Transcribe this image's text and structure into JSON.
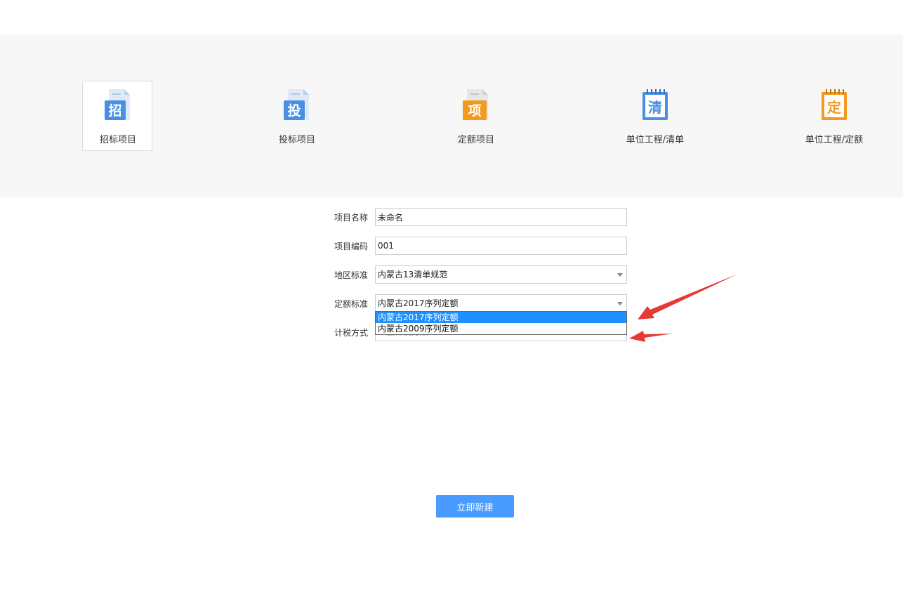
{
  "project_types": [
    {
      "label": "招标项目",
      "icon_glyph": "招",
      "icon": "tender-doc-icon",
      "color": "#4a90e2",
      "selected": true
    },
    {
      "label": "投标项目",
      "icon_glyph": "投",
      "icon": "bid-doc-icon",
      "color": "#4a90e2",
      "selected": false
    },
    {
      "label": "定额项目",
      "icon_glyph": "项",
      "icon": "quota-project-doc-icon",
      "color": "#f39a1e",
      "selected": false
    },
    {
      "label": "单位工程/清单",
      "icon_glyph": "清",
      "icon": "unit-list-notepad-icon",
      "color": "#4a90e2",
      "selected": false
    },
    {
      "label": "单位工程/定额",
      "icon_glyph": "定",
      "icon": "unit-quota-notepad-icon",
      "color": "#f39a1e",
      "selected": false
    }
  ],
  "form": {
    "project_name": {
      "label": "项目名称",
      "value": "未命名"
    },
    "project_code": {
      "label": "项目编码",
      "value": "001"
    },
    "region_standard": {
      "label": "地区标准",
      "value": "内蒙古13清单规范"
    },
    "quota_standard": {
      "label": "定额标准",
      "value": "内蒙古2017序列定额",
      "options": [
        "内蒙古2017序列定额",
        "内蒙古2009序列定额"
      ],
      "highlighted_index": 0
    },
    "tax_method": {
      "label": "计税方式",
      "value": "一般计税方法"
    }
  },
  "create_button_label": "立即新建",
  "colors": {
    "accent": "#4a9bff",
    "highlight": "#1e90ff",
    "annotation_arrow": "#e53935",
    "band_background": "#f7f7f7"
  }
}
